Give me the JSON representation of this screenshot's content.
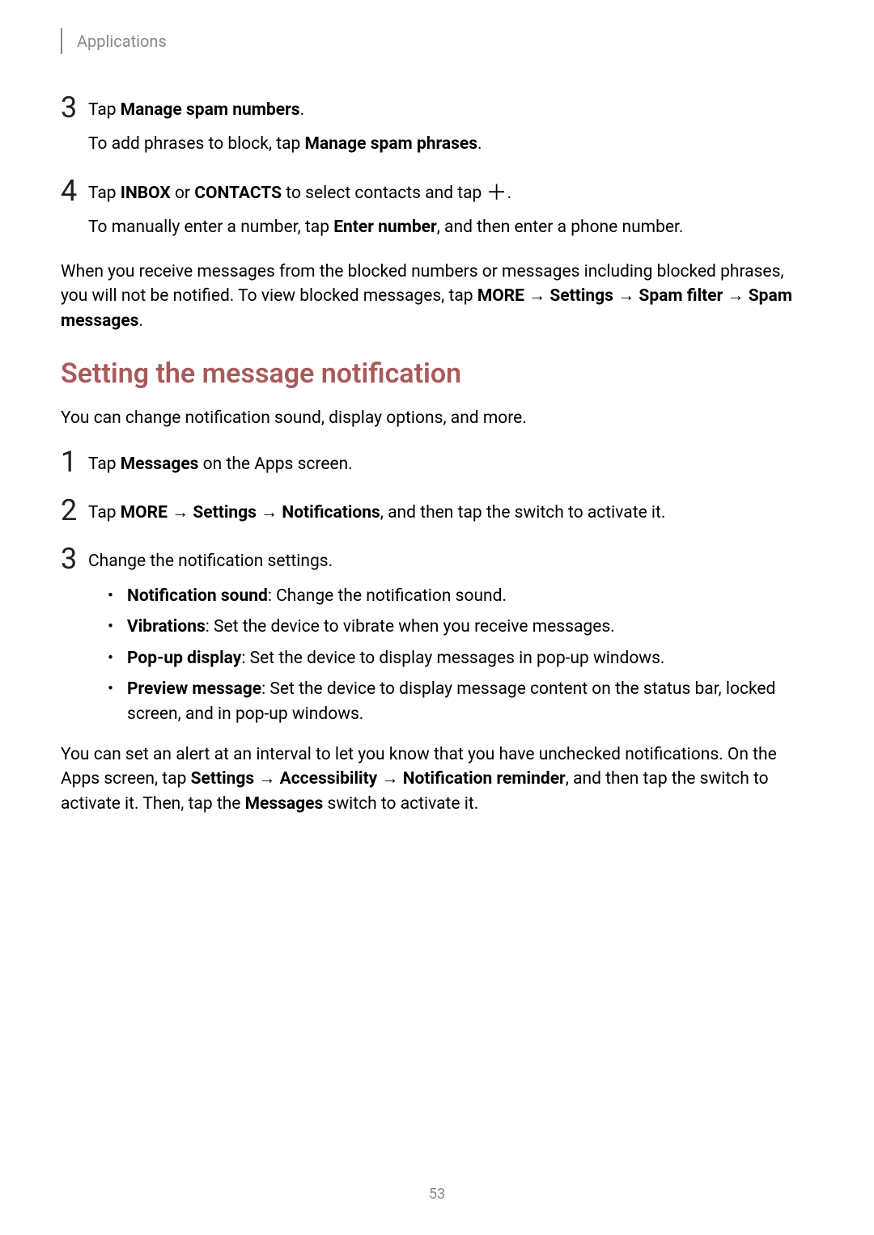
{
  "header": {
    "section": "Applications"
  },
  "steps_a": {
    "3": {
      "line1_pre": "Tap ",
      "line1_bold": "Manage spam numbers",
      "line1_post": ".",
      "line2_pre": "To add phrases to block, tap ",
      "line2_bold": "Manage spam phrases",
      "line2_post": "."
    },
    "4": {
      "line1_pre": "Tap ",
      "line1_b1": "INBOX",
      "line1_mid1": " or ",
      "line1_b2": "CONTACTS",
      "line1_mid2": " to select contacts and tap ",
      "line1_post": ".",
      "line2_pre": "To manually enter a number, tap ",
      "line2_bold": "Enter number",
      "line2_post": ", and then enter a phone number."
    }
  },
  "para1": {
    "pre": "When you receive messages from the blocked numbers or messages including blocked phrases, you will not be notified. To view blocked messages, tap ",
    "b1": "MORE",
    "arr1": " → ",
    "b2": "Settings",
    "arr2": " → ",
    "b3": "Spam filter",
    "arr3": " → ",
    "b4": "Spam messages",
    "post": "."
  },
  "heading": "Setting the message notification",
  "para2": "You can change notification sound, display options, and more.",
  "steps_b": {
    "1": {
      "pre": "Tap ",
      "bold": "Messages",
      "post": " on the Apps screen."
    },
    "2": {
      "pre": "Tap ",
      "b1": "MORE",
      "arr1": " → ",
      "b2": "Settings",
      "arr2": " → ",
      "b3": "Notifications",
      "post": ", and then tap the switch to activate it."
    },
    "3": {
      "main": "Change the notification settings.",
      "bullets": [
        {
          "b": "Notification sound",
          "t": ": Change the notification sound."
        },
        {
          "b": "Vibrations",
          "t": ": Set the device to vibrate when you receive messages."
        },
        {
          "b": "Pop-up display",
          "t": ": Set the device to display messages in pop-up windows."
        },
        {
          "b": "Preview message",
          "t": ": Set the device to display message content on the status bar, locked screen, and in pop-up windows."
        }
      ]
    }
  },
  "para3": {
    "pre": "You can set an alert at an interval to let you know that you have unchecked notifications. On the Apps screen, tap ",
    "b1": "Settings",
    "arr1": " → ",
    "b2": "Accessibility",
    "arr2": " → ",
    "b3": "Notification reminder",
    "mid": ", and then tap the switch to activate it. Then, tap the ",
    "b4": "Messages",
    "post": " switch to activate it."
  },
  "page_number": "53",
  "icons": {
    "plus": "＋"
  }
}
